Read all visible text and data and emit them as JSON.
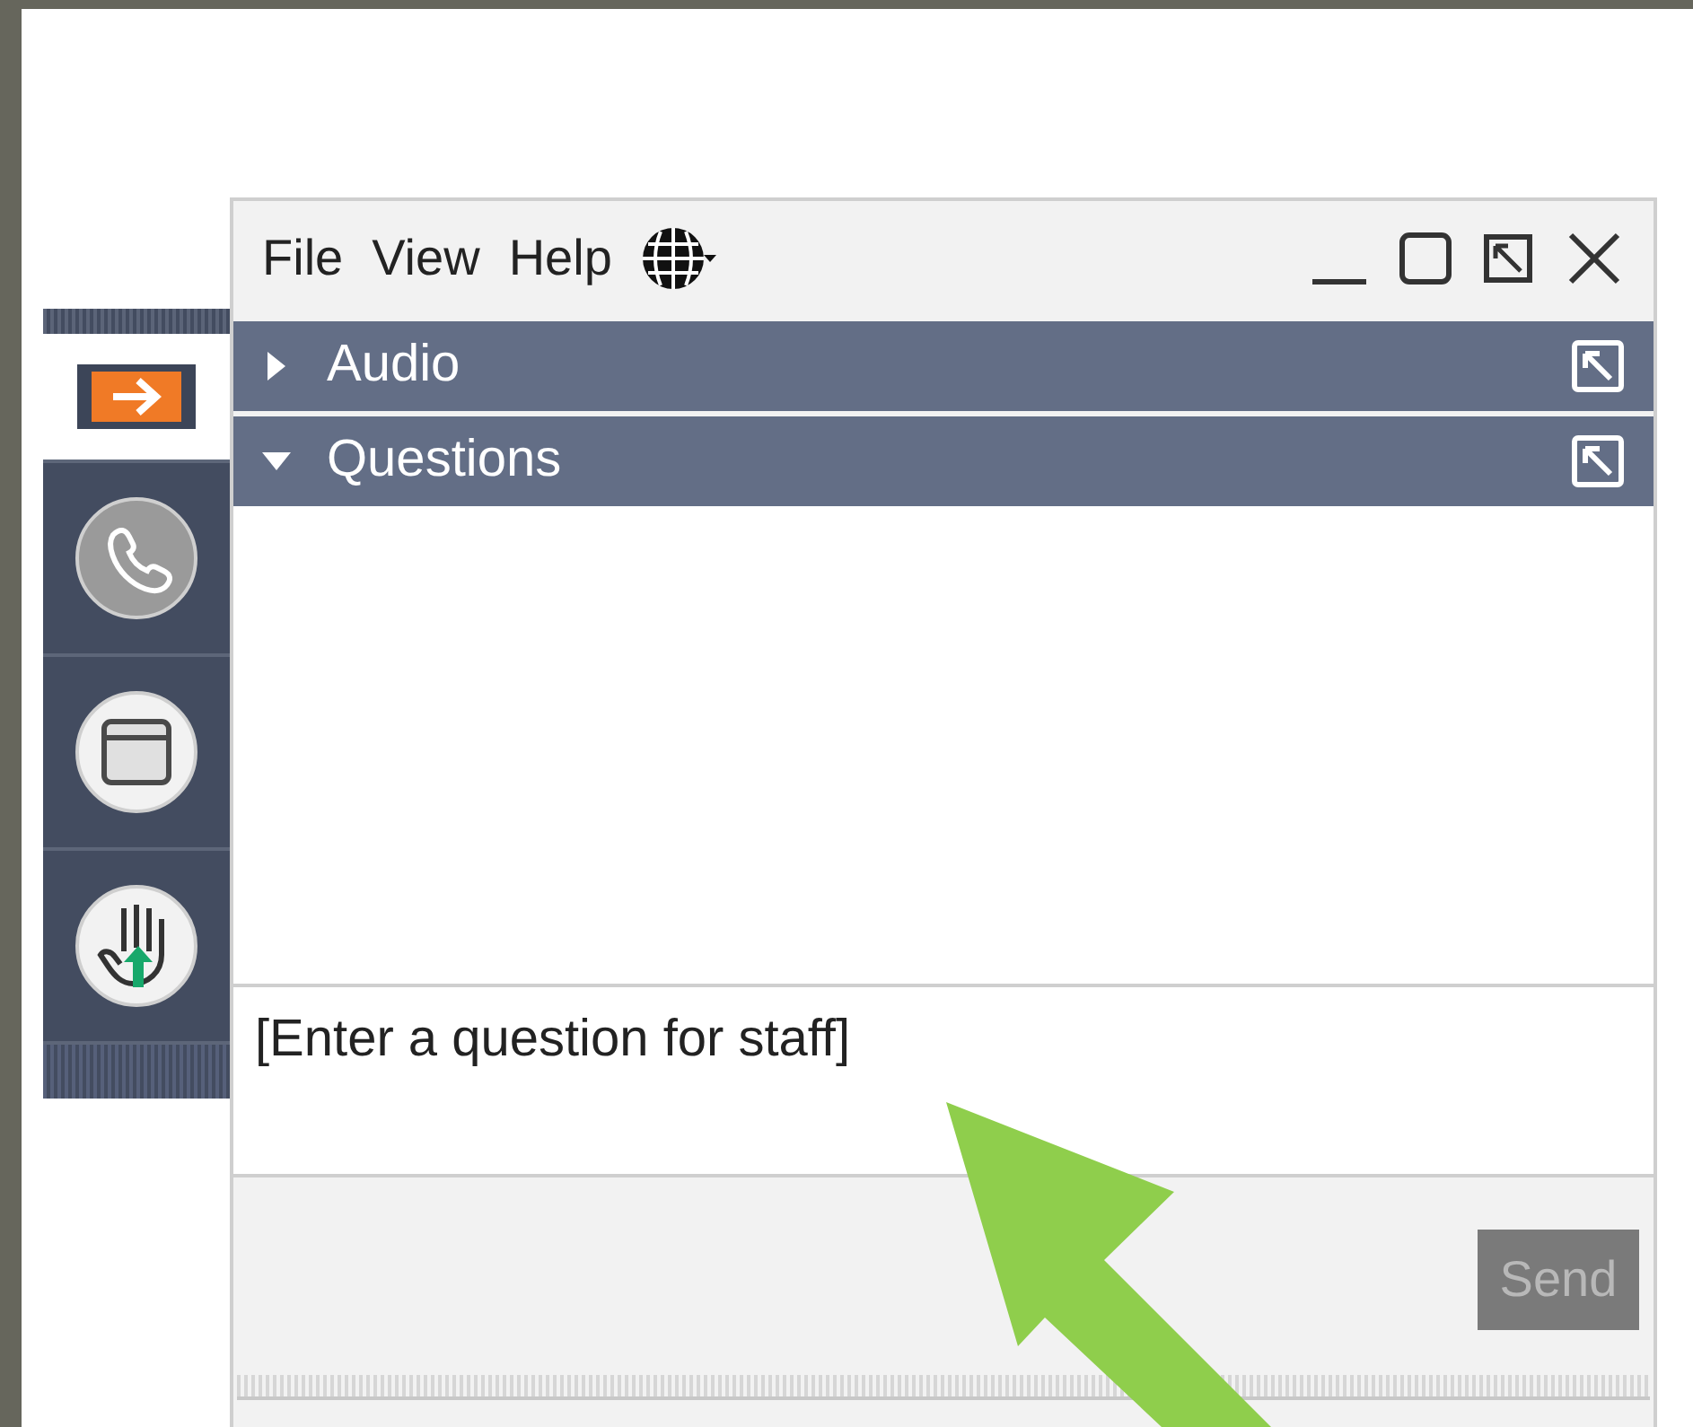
{
  "rail": [
    {
      "kind": "grab",
      "selected": true
    },
    {
      "kind": "phone",
      "selected": false
    },
    {
      "kind": "screen",
      "selected": false
    },
    {
      "kind": "hand",
      "selected": false
    }
  ],
  "menu": [
    "File",
    "View",
    "Help"
  ],
  "panes": [
    {
      "title": "Audio",
      "expanded": false
    },
    {
      "title": "Questions",
      "expanded": true
    }
  ],
  "question_field": {
    "placeholder": "[Enter a question for staff]"
  },
  "send_button": {
    "label": "Send",
    "disabled": true
  }
}
